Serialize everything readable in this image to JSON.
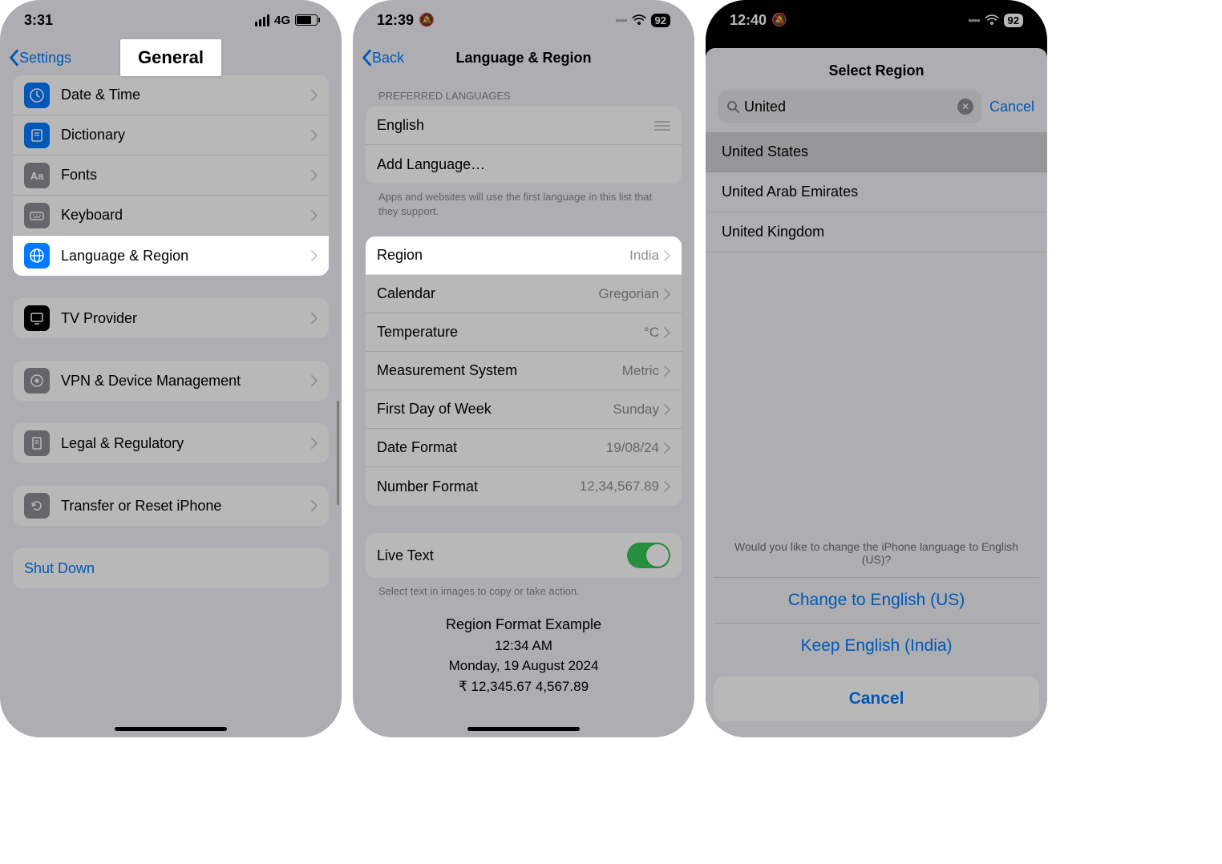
{
  "s1": {
    "time": "3:31",
    "net": "4G",
    "back": "Settings",
    "title": "General",
    "rows_a": [
      {
        "label": "Date & Time",
        "name": "date-time",
        "bg": "#007aff"
      },
      {
        "label": "Dictionary",
        "name": "dictionary",
        "bg": "#007aff"
      },
      {
        "label": "Fonts",
        "name": "fonts",
        "bg": "#8e8e93"
      },
      {
        "label": "Keyboard",
        "name": "keyboard",
        "bg": "#8e8e93"
      },
      {
        "label": "Language & Region",
        "name": "language-region",
        "bg": "#007aff",
        "hl": true
      }
    ],
    "rows_b": [
      {
        "label": "TV Provider",
        "name": "tv-provider",
        "bg": "#000"
      }
    ],
    "rows_c": [
      {
        "label": "VPN & Device Management",
        "name": "vpn",
        "bg": "#8e8e93"
      }
    ],
    "rows_d": [
      {
        "label": "Legal & Regulatory",
        "name": "legal",
        "bg": "#8e8e93"
      }
    ],
    "rows_e": [
      {
        "label": "Transfer or Reset iPhone",
        "name": "reset",
        "bg": "#8e8e93"
      }
    ],
    "shutdown": "Shut Down"
  },
  "s2": {
    "time": "12:39",
    "batt": "92",
    "back": "Back",
    "title": "Language & Region",
    "sec_header": "PREFERRED LANGUAGES",
    "lang": "English",
    "add_lang": "Add Language…",
    "lang_footer": "Apps and websites will use the first language in this list that they support.",
    "region_rows": [
      {
        "label": "Region",
        "val": "India",
        "name": "region",
        "hl": true
      },
      {
        "label": "Calendar",
        "val": "Gregorian",
        "name": "calendar"
      },
      {
        "label": "Temperature",
        "val": "°C",
        "name": "temperature"
      },
      {
        "label": "Measurement System",
        "val": "Metric",
        "name": "measurement"
      },
      {
        "label": "First Day of Week",
        "val": "Sunday",
        "name": "first-day"
      },
      {
        "label": "Date Format",
        "val": "19/08/24",
        "name": "date-format"
      },
      {
        "label": "Number Format",
        "val": "12,34,567.89",
        "name": "number-format"
      }
    ],
    "live_text": "Live Text",
    "live_text_footer": "Select text in images to copy or take action.",
    "example": {
      "title": "Region Format Example",
      "time": "12:34 AM",
      "date": "Monday, 19 August 2024",
      "nums": "₹ 12,345.67   4,567.89"
    }
  },
  "s3": {
    "time": "12:40",
    "batt": "92",
    "sheet_title": "Select Region",
    "search_value": "United",
    "cancel": "Cancel",
    "results": [
      {
        "label": "United States",
        "name": "united-states",
        "sel": true
      },
      {
        "label": "United Arab Emirates",
        "name": "uae"
      },
      {
        "label": "United Kingdom",
        "name": "uk"
      }
    ],
    "prompt": {
      "msg": "Would you like to change the iPhone language to English (US)?",
      "opt1": "Change to English (US)",
      "opt2": "Keep English (India)",
      "cancel": "Cancel"
    }
  }
}
